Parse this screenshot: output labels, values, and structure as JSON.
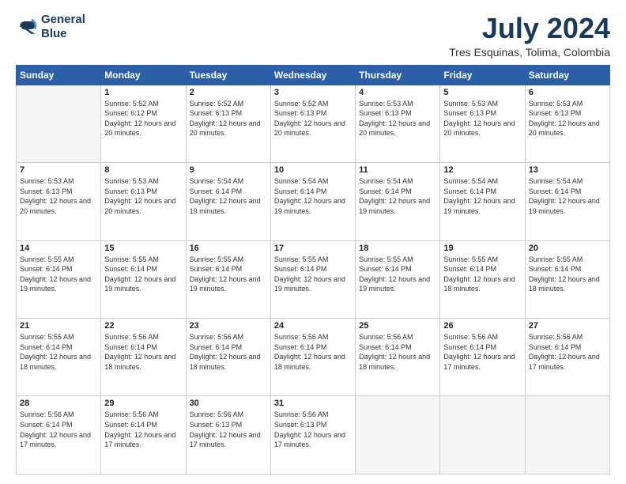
{
  "header": {
    "logo_line1": "General",
    "logo_line2": "Blue",
    "title": "July 2024",
    "subtitle": "Tres Esquinas, Tolima, Colombia"
  },
  "weekdays": [
    "Sunday",
    "Monday",
    "Tuesday",
    "Wednesday",
    "Thursday",
    "Friday",
    "Saturday"
  ],
  "weeks": [
    [
      {
        "day": "",
        "empty": true
      },
      {
        "day": "1",
        "sunrise": "5:52 AM",
        "sunset": "6:12 PM",
        "daylight": "12 hours and 20 minutes."
      },
      {
        "day": "2",
        "sunrise": "5:52 AM",
        "sunset": "6:13 PM",
        "daylight": "12 hours and 20 minutes."
      },
      {
        "day": "3",
        "sunrise": "5:52 AM",
        "sunset": "6:13 PM",
        "daylight": "12 hours and 20 minutes."
      },
      {
        "day": "4",
        "sunrise": "5:53 AM",
        "sunset": "6:13 PM",
        "daylight": "12 hours and 20 minutes."
      },
      {
        "day": "5",
        "sunrise": "5:53 AM",
        "sunset": "6:13 PM",
        "daylight": "12 hours and 20 minutes."
      },
      {
        "day": "6",
        "sunrise": "5:53 AM",
        "sunset": "6:13 PM",
        "daylight": "12 hours and 20 minutes."
      }
    ],
    [
      {
        "day": "7",
        "sunrise": "5:53 AM",
        "sunset": "6:13 PM",
        "daylight": "12 hours and 20 minutes."
      },
      {
        "day": "8",
        "sunrise": "5:53 AM",
        "sunset": "6:13 PM",
        "daylight": "12 hours and 20 minutes."
      },
      {
        "day": "9",
        "sunrise": "5:54 AM",
        "sunset": "6:14 PM",
        "daylight": "12 hours and 19 minutes."
      },
      {
        "day": "10",
        "sunrise": "5:54 AM",
        "sunset": "6:14 PM",
        "daylight": "12 hours and 19 minutes."
      },
      {
        "day": "11",
        "sunrise": "5:54 AM",
        "sunset": "6:14 PM",
        "daylight": "12 hours and 19 minutes."
      },
      {
        "day": "12",
        "sunrise": "5:54 AM",
        "sunset": "6:14 PM",
        "daylight": "12 hours and 19 minutes."
      },
      {
        "day": "13",
        "sunrise": "5:54 AM",
        "sunset": "6:14 PM",
        "daylight": "12 hours and 19 minutes."
      }
    ],
    [
      {
        "day": "14",
        "sunrise": "5:55 AM",
        "sunset": "6:14 PM",
        "daylight": "12 hours and 19 minutes."
      },
      {
        "day": "15",
        "sunrise": "5:55 AM",
        "sunset": "6:14 PM",
        "daylight": "12 hours and 19 minutes."
      },
      {
        "day": "16",
        "sunrise": "5:55 AM",
        "sunset": "6:14 PM",
        "daylight": "12 hours and 19 minutes."
      },
      {
        "day": "17",
        "sunrise": "5:55 AM",
        "sunset": "6:14 PM",
        "daylight": "12 hours and 19 minutes."
      },
      {
        "day": "18",
        "sunrise": "5:55 AM",
        "sunset": "6:14 PM",
        "daylight": "12 hours and 19 minutes."
      },
      {
        "day": "19",
        "sunrise": "5:55 AM",
        "sunset": "6:14 PM",
        "daylight": "12 hours and 18 minutes."
      },
      {
        "day": "20",
        "sunrise": "5:55 AM",
        "sunset": "6:14 PM",
        "daylight": "12 hours and 18 minutes."
      }
    ],
    [
      {
        "day": "21",
        "sunrise": "5:55 AM",
        "sunset": "6:14 PM",
        "daylight": "12 hours and 18 minutes."
      },
      {
        "day": "22",
        "sunrise": "5:56 AM",
        "sunset": "6:14 PM",
        "daylight": "12 hours and 18 minutes."
      },
      {
        "day": "23",
        "sunrise": "5:56 AM",
        "sunset": "6:14 PM",
        "daylight": "12 hours and 18 minutes."
      },
      {
        "day": "24",
        "sunrise": "5:56 AM",
        "sunset": "6:14 PM",
        "daylight": "12 hours and 18 minutes."
      },
      {
        "day": "25",
        "sunrise": "5:56 AM",
        "sunset": "6:14 PM",
        "daylight": "12 hours and 18 minutes."
      },
      {
        "day": "26",
        "sunrise": "5:56 AM",
        "sunset": "6:14 PM",
        "daylight": "12 hours and 17 minutes."
      },
      {
        "day": "27",
        "sunrise": "5:56 AM",
        "sunset": "6:14 PM",
        "daylight": "12 hours and 17 minutes."
      }
    ],
    [
      {
        "day": "28",
        "sunrise": "5:56 AM",
        "sunset": "6:14 PM",
        "daylight": "12 hours and 17 minutes."
      },
      {
        "day": "29",
        "sunrise": "5:56 AM",
        "sunset": "6:14 PM",
        "daylight": "12 hours and 17 minutes."
      },
      {
        "day": "30",
        "sunrise": "5:56 AM",
        "sunset": "6:13 PM",
        "daylight": "12 hours and 17 minutes."
      },
      {
        "day": "31",
        "sunrise": "5:56 AM",
        "sunset": "6:13 PM",
        "daylight": "12 hours and 17 minutes."
      },
      {
        "day": "",
        "empty": true
      },
      {
        "day": "",
        "empty": true
      },
      {
        "day": "",
        "empty": true
      }
    ]
  ]
}
